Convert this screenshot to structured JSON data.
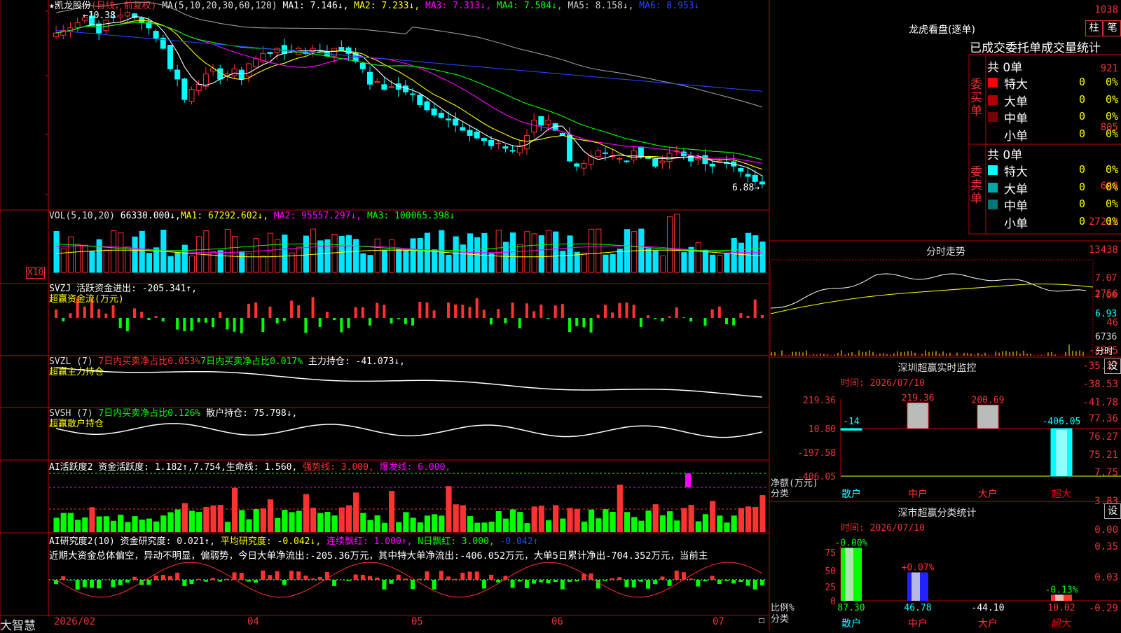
{
  "colors": {
    "up": "#ff3232",
    "down": "#00ffff",
    "vol_up": "#ff3232",
    "vol_down": "#00e4ff",
    "green": "#00ff00",
    "yellow": "#ffff00",
    "magenta": "#ff00ff",
    "white": "#ffffff",
    "blue": "#2244ff",
    "gray": "#9a9a9a",
    "axis": "#c00000"
  },
  "header": {
    "star": "★",
    "stock": "凯龙股份",
    "period": "(日线，前复权)",
    "ma_label": "MA(5,10,20,30,60,120)",
    "ma1": "MA1: 7.146↓,",
    "ma2": "MA2: 7.233↓,",
    "ma3": "MA3: 7.313↓,",
    "ma4": "MA4: 7.504↓,",
    "ma5": "MA5: 8.158↓,",
    "ma6": "MA6: 8.953↓",
    "ma_colors": [
      "#ffffff",
      "#ffff00",
      "#ff00ff",
      "#00ff00",
      "#c0c0c0",
      "#2244ff"
    ]
  },
  "price_panel": {
    "y_ticks": [
      "1038",
      "921",
      "805",
      "688"
    ],
    "high_label": "←10.38",
    "low_label": "6.88→"
  },
  "vol_panel": {
    "legend_a": "VOL(5,10,20)",
    "legend_b": "66330.000↓,",
    "legend_c": "MA1: 67292.602↓,",
    "legend_d": "MA2: 95557.297↓,",
    "legend_e": "MA3: 100065.398↓",
    "y_ticks": [
      "27212",
      "13438"
    ],
    "unit": "X10"
  },
  "svzj_panel": {
    "line1": "SVZJ  活跃资金进出: -205.341↑,",
    "line2": "超赢资金流(万元)",
    "y_ticks": [
      "2756",
      "46",
      "-2665"
    ]
  },
  "svzl_panel": {
    "l1": "SVZL (7)",
    "l2": "7日内买卖净占比0.053%",
    "l3": "7日内买卖净占比0.017%",
    "l4": "主力持仓: -41.073↓,",
    "line2": "超赢主力持仓",
    "y_ticks": [
      "-35.27",
      "-38.53",
      "-41.78"
    ]
  },
  "svsh_panel": {
    "l1": "SVSH (7)",
    "l2": "7日内买卖净占比0.126%",
    "l3": "散户持仓: 75.798↓,",
    "line2": "超赢散户持仓",
    "y_ticks": [
      "77.36",
      "76.27",
      "75.21"
    ]
  },
  "ai_act": {
    "l1": "AI活跃度2 资金活跃度: 1.182↑,7.754,生命线: 1.560,",
    "l2": "强势线: 3.000,",
    "l3": "爆发线: 6.000,",
    "y_ticks": [
      "7.75",
      "3.83",
      "0.00"
    ]
  },
  "ai_res": {
    "l1": "AI研究度2(10) 资金研究度: 0.021↑,",
    "l2": "平均研究度: -0.042↓,",
    "l3": "连续飘红: 1.000↑,",
    "l4": "N日飘红: 3.000,",
    "l5": "-0.042↑",
    "text": "近期大资金总体偏空，异动不明显，偏弱势，今日大单净流出:-205.36万元，其中特大单净流出:-406.052万元，大单5日累计净出-704.352万元，当前主",
    "y_ticks": [
      "0.35",
      "0.03",
      "-0.29"
    ]
  },
  "bottom": {
    "brand": "大智慧",
    "dates": [
      "2026/02",
      "04",
      "05",
      "06",
      "07"
    ]
  },
  "right": {
    "dragon_title": "龙虎看盘(逐单)",
    "btn_bar": "柱",
    "btn_pen": "笔",
    "stats_title": "已成交委托单成交量统计",
    "buy_side": "委买单",
    "sell_side": "委卖单",
    "buy_total": "共 0单",
    "sell_total": "共 0单",
    "buy_rows": [
      {
        "label": "特大",
        "v": "0",
        "p": "0%",
        "c": "#ff0000"
      },
      {
        "label": "大单",
        "v": "0",
        "p": "0%",
        "c": "#b00000"
      },
      {
        "label": "中单",
        "v": "0",
        "p": "0%",
        "c": "#7a0000"
      },
      {
        "label": "小单",
        "v": "0",
        "p": "0%",
        "c": ""
      }
    ],
    "sell_rows": [
      {
        "label": "特大",
        "v": "0",
        "p": "0%",
        "c": "#00ffff"
      },
      {
        "label": "大单",
        "v": "0",
        "p": "0%",
        "c": "#00a8a8"
      },
      {
        "label": "中单",
        "v": "0",
        "p": "0%",
        "c": "#007878"
      },
      {
        "label": "小单",
        "v": "0",
        "p": "0%",
        "c": ""
      }
    ],
    "minute_title": "分时走势",
    "minute_ticks": [
      "7.07",
      "7.00",
      "6.93"
    ],
    "minute_vol": "6736",
    "minute_unit": "分时",
    "monitor_title": "深圳超赢实时监控",
    "set1": "设",
    "monitor_time": "时间: 2026/07/10",
    "monitor_ticks": [
      "219.36",
      "10.80",
      "-197.58",
      "-406.05"
    ],
    "monitor_axis": "净额(万元)",
    "monitor_axis2": "分类",
    "monitor_cats": [
      "散户",
      "中户",
      "大户",
      "超大"
    ],
    "monitor_vals": [
      "-14",
      "219.36",
      "200.69",
      "-406.05"
    ],
    "class_title": "深市超赢分类统计",
    "set2": "设",
    "class_time": "时间: 2026/07/10",
    "class_ticks": [
      "75",
      "50",
      "25",
      "0"
    ],
    "class_axis": "比例%",
    "class_axis2": "分类",
    "class_cats": [
      "散户",
      "中户",
      "大户",
      "超大"
    ],
    "class_top": [
      "-0.00%",
      "+0.07%",
      "",
      "-0.13%"
    ],
    "class_bottom": [
      "87.30",
      "46.78",
      "-44.10",
      "10.02"
    ]
  }
}
